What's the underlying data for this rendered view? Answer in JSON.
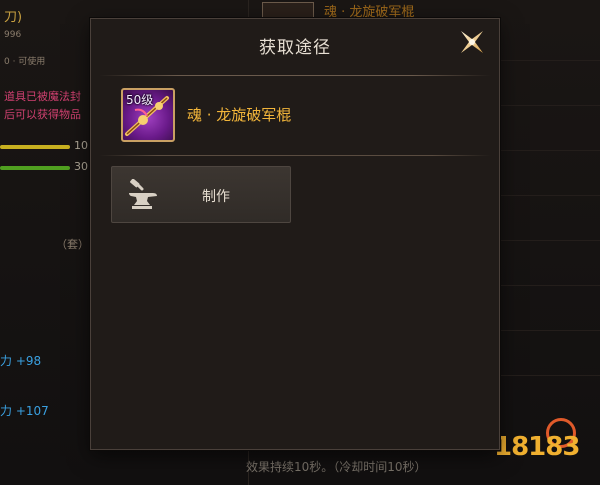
{
  "background": {
    "left_texts": [
      {
        "text": "刀)",
        "color": "#c8a040"
      },
      {
        "text": "996",
        "color": "#8a7c6c"
      },
      {
        "text": "0 · 可使用",
        "color": "#8a7c6c"
      },
      {
        "text": "道具已被魔法封",
        "color": "#d04070"
      },
      {
        "text": "后可以获得物品",
        "color": "#d04070"
      },
      {
        "text": "10",
        "color": "#b0a898"
      },
      {
        "text": "30",
        "color": "#b0a898"
      },
      {
        "text": "（套）",
        "color": "#8a7c6c"
      },
      {
        "text": "力 +98",
        "color": "#3aa0e0"
      },
      {
        "text": "力 +107",
        "color": "#3aa0e0"
      }
    ],
    "top_right_title": "魂 · 龙旋破军棍",
    "bottom_text": "效果持续10秒。（冷却时间10秒）",
    "watermark": "18183"
  },
  "modal": {
    "title": "获取途径",
    "item": {
      "level": "50级",
      "name": "魂 · 龙旋破军棍",
      "name_color": "#f2b53a"
    },
    "sources": [
      {
        "label": "制作",
        "icon": "anvil-icon"
      }
    ]
  }
}
